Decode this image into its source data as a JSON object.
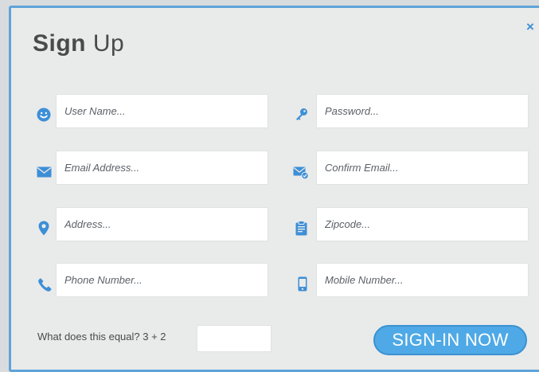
{
  "modal": {
    "title_part1": "Sign",
    "title_part2": "Up",
    "close_glyph": "×"
  },
  "fields": {
    "username": {
      "placeholder": "User Name...",
      "icon": "smiley-icon"
    },
    "password": {
      "placeholder": "Password...",
      "icon": "key-icon"
    },
    "email": {
      "placeholder": "Email Address...",
      "icon": "envelope-icon"
    },
    "confirm_email": {
      "placeholder": "Confirm Email...",
      "icon": "envelope-check-icon"
    },
    "address": {
      "placeholder": "Address...",
      "icon": "location-pin-icon"
    },
    "zipcode": {
      "placeholder": "Zipcode...",
      "icon": "clipboard-icon"
    },
    "phone": {
      "placeholder": "Phone Number...",
      "icon": "phone-icon"
    },
    "mobile": {
      "placeholder": "Mobile Number...",
      "icon": "mobile-icon"
    }
  },
  "captcha": {
    "label": "What does this equal? 3 + 2",
    "value": ""
  },
  "submit_label": "SIGN-IN NOW",
  "colors": {
    "accent": "#3d8fd6",
    "button": "#4ea9e6",
    "border": "#5fa3d9",
    "text": "#4a4a4a"
  }
}
